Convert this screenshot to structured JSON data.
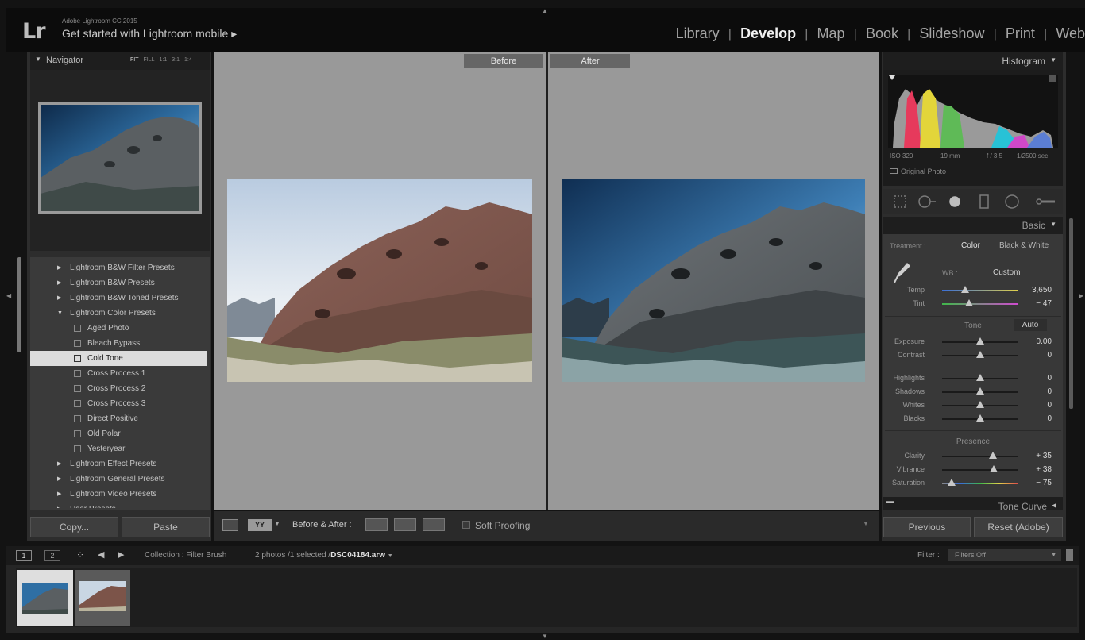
{
  "colors": {
    "app_bg": "#131313",
    "panel_bg": "#2d2d2d",
    "canvas_bg": "#999999",
    "selected_row": "#dcdcdc"
  },
  "identity": {
    "logo": "Lr",
    "version": "Adobe Lightroom CC 2015",
    "mobile": "Get started with Lightroom mobile",
    "mobile_arrow": "▸"
  },
  "modules": [
    "Library",
    "Develop",
    "Map",
    "Book",
    "Slideshow",
    "Print",
    "Web"
  ],
  "active_module": "Develop",
  "navigator": {
    "title": "Navigator",
    "zoom": [
      "FIT",
      "FILL",
      "1:1",
      "3:1",
      "1:4"
    ]
  },
  "presets": [
    {
      "label": "Lightroom B&W Filter Presets",
      "type": "folder"
    },
    {
      "label": "Lightroom B&W Presets",
      "type": "folder"
    },
    {
      "label": "Lightroom B&W Toned Presets",
      "type": "folder"
    },
    {
      "label": "Lightroom Color Presets",
      "type": "folder-open"
    },
    {
      "label": "Aged Photo",
      "type": "item"
    },
    {
      "label": "Bleach Bypass",
      "type": "item"
    },
    {
      "label": "Cold Tone",
      "type": "item",
      "selected": true
    },
    {
      "label": "Cross Process 1",
      "type": "item"
    },
    {
      "label": "Cross Process 2",
      "type": "item"
    },
    {
      "label": "Cross Process 3",
      "type": "item"
    },
    {
      "label": "Direct Positive",
      "type": "item"
    },
    {
      "label": "Old Polar",
      "type": "item"
    },
    {
      "label": "Yesteryear",
      "type": "item"
    },
    {
      "label": "Lightroom Effect Presets",
      "type": "folder"
    },
    {
      "label": "Lightroom General Presets",
      "type": "folder"
    },
    {
      "label": "Lightroom Video Presets",
      "type": "folder"
    },
    {
      "label": "User Presets",
      "type": "folder"
    }
  ],
  "left_buttons": {
    "copy": "Copy...",
    "paste": "Paste"
  },
  "compare": {
    "before": "Before",
    "after": "After"
  },
  "toolbar": {
    "before_after": "Before & After :",
    "soft_proofing": "Soft Proofing"
  },
  "histogram": {
    "title": "Histogram",
    "iso": "ISO 320",
    "focal": "19 mm",
    "aperture": "f / 3.5",
    "shutter": "1/2500 sec",
    "original": "Original Photo"
  },
  "basic": {
    "title": "Basic",
    "treatment_label": "Treatment :",
    "color": "Color",
    "bw": "Black & White",
    "wb_label": "WB :",
    "wb_value": "Custom",
    "tone_label": "Tone",
    "auto": "Auto",
    "presence_label": "Presence",
    "wb_sliders": [
      {
        "name": "Temp",
        "value": "3,650",
        "pos": 0.3
      },
      {
        "name": "Tint",
        "value": "− 47",
        "pos": 0.35
      }
    ],
    "tone_sliders": [
      {
        "name": "Exposure",
        "value": "0.00",
        "pos": 0.5
      },
      {
        "name": "Contrast",
        "value": "0",
        "pos": 0.5
      }
    ],
    "tone_sliders2": [
      {
        "name": "Highlights",
        "value": "0",
        "pos": 0.5
      },
      {
        "name": "Shadows",
        "value": "0",
        "pos": 0.5
      },
      {
        "name": "Whites",
        "value": "0",
        "pos": 0.5
      },
      {
        "name": "Blacks",
        "value": "0",
        "pos": 0.5
      }
    ],
    "presence_sliders": [
      {
        "name": "Clarity",
        "value": "+ 35",
        "pos": 0.67
      },
      {
        "name": "Vibrance",
        "value": "+ 38",
        "pos": 0.68
      },
      {
        "name": "Saturation",
        "value": "− 75",
        "pos": 0.13
      }
    ]
  },
  "tone_curve": {
    "title": "Tone Curve"
  },
  "right_buttons": {
    "previous": "Previous",
    "reset": "Reset (Adobe)"
  },
  "filmstrip": {
    "page1": "1",
    "page2": "2",
    "source": "Collection : Filter Brush",
    "count": "2 photos /1 selected /",
    "filename": "DSC04184.arw",
    "filter_label": "Filter :",
    "filter_value": "Filters Off"
  }
}
